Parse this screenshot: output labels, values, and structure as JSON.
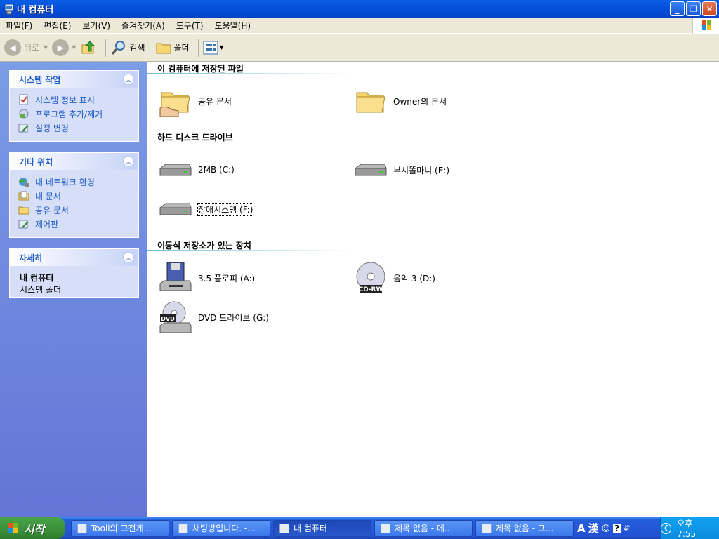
{
  "window": {
    "title": "내 컴퓨터"
  },
  "menu": [
    "파일(F)",
    "편집(E)",
    "보기(V)",
    "즐겨찾기(A)",
    "도구(T)",
    "도움말(H)"
  ],
  "toolbar": {
    "back_label": "뒤로",
    "search_label": "검색",
    "folders_label": "폴더"
  },
  "sidebar": {
    "system_tasks": {
      "title": "시스템 작업",
      "items": [
        "시스템 정보 표시",
        "프로그램 추가/제거",
        "설정 변경"
      ]
    },
    "other_places": {
      "title": "기타 위치",
      "items": [
        "내 네트워크 환경",
        "내 문서",
        "공유 문서",
        "제어판"
      ]
    },
    "details": {
      "title": "자세히",
      "name": "내 컴퓨터",
      "type": "시스템 폴더"
    }
  },
  "main": {
    "sections": [
      {
        "title": "이 컴퓨터에 저장된 파일",
        "items": [
          "공유 문서",
          "Owner의 문서"
        ]
      },
      {
        "title": "하드 디스크 드라이브",
        "items": [
          "2MB (C:)",
          "부시똘마니 (E:)",
          "장애시스템 (F:)"
        ]
      },
      {
        "title": "이동식 저장소가 있는 장치",
        "items": [
          "3.5 플로피 (A:)",
          "음악 3 (D:)",
          "DVD 드라이브 (G:)"
        ]
      }
    ]
  },
  "taskbar": {
    "start_label": "시작",
    "tasks": [
      "Tooli의 고전게...",
      "채팅방입니다. -...",
      "내 컴퓨터",
      "제목 없음 - 메...",
      "제목 없음 - 그..."
    ],
    "ime_a": "A",
    "ime_han": "漢",
    "clock": "오후 7:55"
  },
  "colors": {
    "title_blue": "#0551dc",
    "side_link": "#215dc6",
    "taskbar_blue": "#245edb",
    "start_green": "#3c8f3c"
  },
  "icons": [
    "folder-icon",
    "shared-folder-icon",
    "hard-drive-icon",
    "floppy-icon",
    "cdrw-icon",
    "dvd-icon"
  ]
}
